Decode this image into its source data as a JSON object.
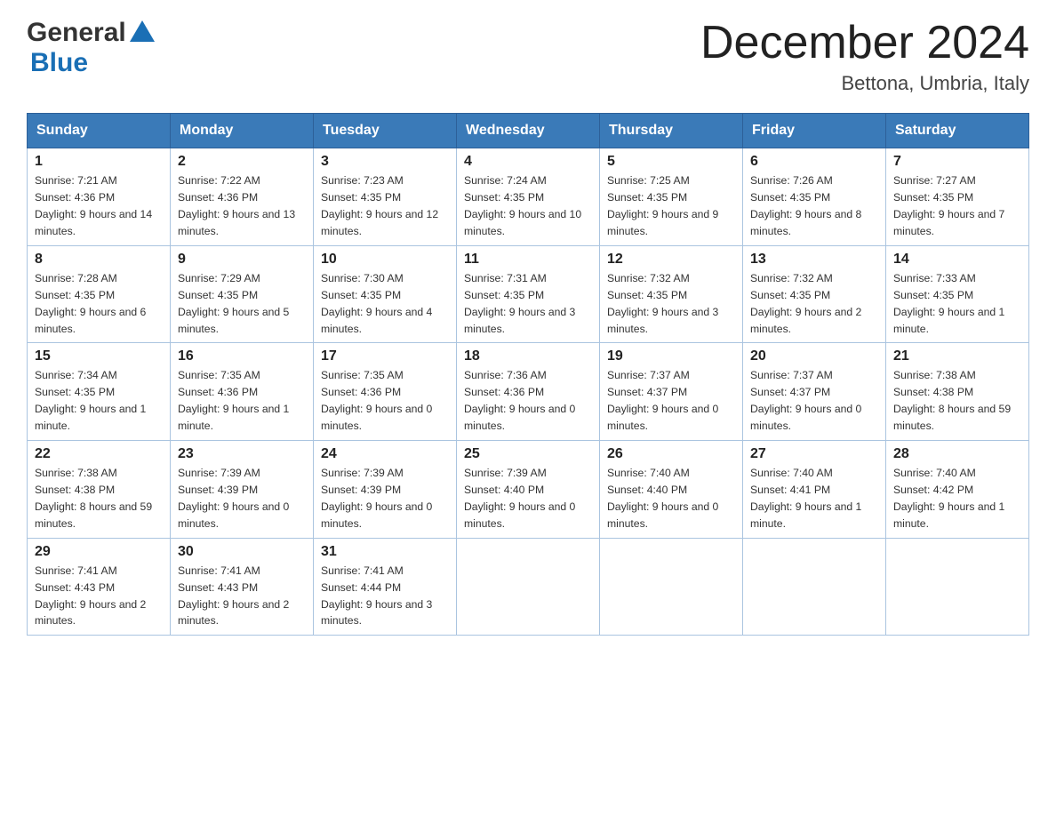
{
  "header": {
    "logo_general": "General",
    "logo_blue": "Blue",
    "month": "December 2024",
    "location": "Bettona, Umbria, Italy"
  },
  "days_of_week": [
    "Sunday",
    "Monday",
    "Tuesday",
    "Wednesday",
    "Thursday",
    "Friday",
    "Saturday"
  ],
  "weeks": [
    [
      {
        "day": "1",
        "sunrise": "7:21 AM",
        "sunset": "4:36 PM",
        "daylight": "9 hours and 14 minutes."
      },
      {
        "day": "2",
        "sunrise": "7:22 AM",
        "sunset": "4:36 PM",
        "daylight": "9 hours and 13 minutes."
      },
      {
        "day": "3",
        "sunrise": "7:23 AM",
        "sunset": "4:35 PM",
        "daylight": "9 hours and 12 minutes."
      },
      {
        "day": "4",
        "sunrise": "7:24 AM",
        "sunset": "4:35 PM",
        "daylight": "9 hours and 10 minutes."
      },
      {
        "day": "5",
        "sunrise": "7:25 AM",
        "sunset": "4:35 PM",
        "daylight": "9 hours and 9 minutes."
      },
      {
        "day": "6",
        "sunrise": "7:26 AM",
        "sunset": "4:35 PM",
        "daylight": "9 hours and 8 minutes."
      },
      {
        "day": "7",
        "sunrise": "7:27 AM",
        "sunset": "4:35 PM",
        "daylight": "9 hours and 7 minutes."
      }
    ],
    [
      {
        "day": "8",
        "sunrise": "7:28 AM",
        "sunset": "4:35 PM",
        "daylight": "9 hours and 6 minutes."
      },
      {
        "day": "9",
        "sunrise": "7:29 AM",
        "sunset": "4:35 PM",
        "daylight": "9 hours and 5 minutes."
      },
      {
        "day": "10",
        "sunrise": "7:30 AM",
        "sunset": "4:35 PM",
        "daylight": "9 hours and 4 minutes."
      },
      {
        "day": "11",
        "sunrise": "7:31 AM",
        "sunset": "4:35 PM",
        "daylight": "9 hours and 3 minutes."
      },
      {
        "day": "12",
        "sunrise": "7:32 AM",
        "sunset": "4:35 PM",
        "daylight": "9 hours and 3 minutes."
      },
      {
        "day": "13",
        "sunrise": "7:32 AM",
        "sunset": "4:35 PM",
        "daylight": "9 hours and 2 minutes."
      },
      {
        "day": "14",
        "sunrise": "7:33 AM",
        "sunset": "4:35 PM",
        "daylight": "9 hours and 1 minute."
      }
    ],
    [
      {
        "day": "15",
        "sunrise": "7:34 AM",
        "sunset": "4:35 PM",
        "daylight": "9 hours and 1 minute."
      },
      {
        "day": "16",
        "sunrise": "7:35 AM",
        "sunset": "4:36 PM",
        "daylight": "9 hours and 1 minute."
      },
      {
        "day": "17",
        "sunrise": "7:35 AM",
        "sunset": "4:36 PM",
        "daylight": "9 hours and 0 minutes."
      },
      {
        "day": "18",
        "sunrise": "7:36 AM",
        "sunset": "4:36 PM",
        "daylight": "9 hours and 0 minutes."
      },
      {
        "day": "19",
        "sunrise": "7:37 AM",
        "sunset": "4:37 PM",
        "daylight": "9 hours and 0 minutes."
      },
      {
        "day": "20",
        "sunrise": "7:37 AM",
        "sunset": "4:37 PM",
        "daylight": "9 hours and 0 minutes."
      },
      {
        "day": "21",
        "sunrise": "7:38 AM",
        "sunset": "4:38 PM",
        "daylight": "8 hours and 59 minutes."
      }
    ],
    [
      {
        "day": "22",
        "sunrise": "7:38 AM",
        "sunset": "4:38 PM",
        "daylight": "8 hours and 59 minutes."
      },
      {
        "day": "23",
        "sunrise": "7:39 AM",
        "sunset": "4:39 PM",
        "daylight": "9 hours and 0 minutes."
      },
      {
        "day": "24",
        "sunrise": "7:39 AM",
        "sunset": "4:39 PM",
        "daylight": "9 hours and 0 minutes."
      },
      {
        "day": "25",
        "sunrise": "7:39 AM",
        "sunset": "4:40 PM",
        "daylight": "9 hours and 0 minutes."
      },
      {
        "day": "26",
        "sunrise": "7:40 AM",
        "sunset": "4:40 PM",
        "daylight": "9 hours and 0 minutes."
      },
      {
        "day": "27",
        "sunrise": "7:40 AM",
        "sunset": "4:41 PM",
        "daylight": "9 hours and 1 minute."
      },
      {
        "day": "28",
        "sunrise": "7:40 AM",
        "sunset": "4:42 PM",
        "daylight": "9 hours and 1 minute."
      }
    ],
    [
      {
        "day": "29",
        "sunrise": "7:41 AM",
        "sunset": "4:43 PM",
        "daylight": "9 hours and 2 minutes."
      },
      {
        "day": "30",
        "sunrise": "7:41 AM",
        "sunset": "4:43 PM",
        "daylight": "9 hours and 2 minutes."
      },
      {
        "day": "31",
        "sunrise": "7:41 AM",
        "sunset": "4:44 PM",
        "daylight": "9 hours and 3 minutes."
      },
      null,
      null,
      null,
      null
    ]
  ]
}
